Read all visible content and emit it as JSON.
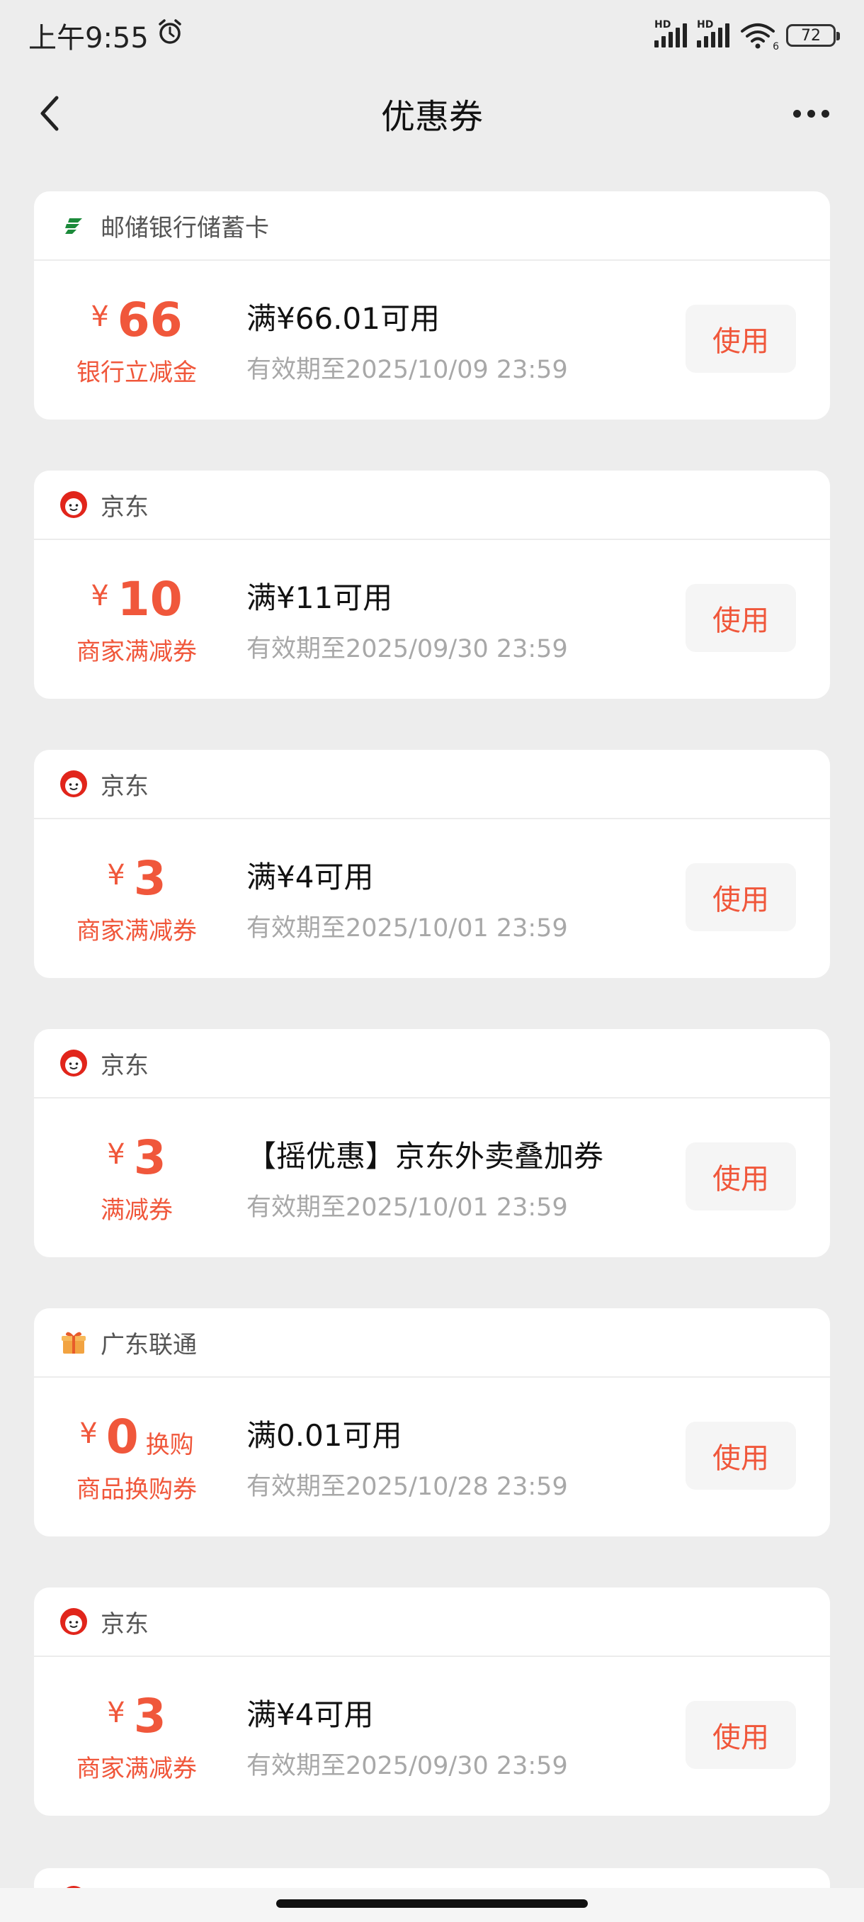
{
  "status_bar": {
    "time": "上午9:55",
    "battery": "72",
    "signal_label": "HD",
    "wifi_label": "6"
  },
  "nav": {
    "title": "优惠券"
  },
  "coupons": [
    {
      "merchant": "邮储银行储蓄卡",
      "logo": "postal-bank-logo-icon",
      "currency": "¥",
      "amount": "66",
      "extra": "",
      "type": "银行立减金",
      "condition": "满¥66.01可用",
      "expiry": "有效期至2025/10/09 23:59",
      "button": "使用"
    },
    {
      "merchant": "京东",
      "logo": "jd-logo-icon",
      "currency": "¥",
      "amount": "10",
      "extra": "",
      "type": "商家满减券",
      "condition": "满¥11可用",
      "expiry": "有效期至2025/09/30 23:59",
      "button": "使用"
    },
    {
      "merchant": "京东",
      "logo": "jd-logo-icon",
      "currency": "¥",
      "amount": "3",
      "extra": "",
      "type": "商家满减券",
      "condition": "满¥4可用",
      "expiry": "有效期至2025/10/01 23:59",
      "button": "使用"
    },
    {
      "merchant": "京东",
      "logo": "jd-logo-icon",
      "currency": "¥",
      "amount": "3",
      "extra": "",
      "type": "满减券",
      "condition": "【摇优惠】京东外卖叠加券",
      "expiry": "有效期至2025/10/01 23:59",
      "button": "使用"
    },
    {
      "merchant": "广东联通",
      "logo": "gift-box-icon",
      "currency": "¥",
      "amount": "0",
      "extra": "换购",
      "type": "商品换购券",
      "condition": "满0.01可用",
      "expiry": "有效期至2025/10/28 23:59",
      "button": "使用"
    },
    {
      "merchant": "京东",
      "logo": "jd-logo-icon",
      "currency": "¥",
      "amount": "3",
      "extra": "",
      "type": "商家满减券",
      "condition": "满¥4可用",
      "expiry": "有效期至2025/09/30 23:59",
      "button": "使用"
    }
  ],
  "colors": {
    "accent": "#f0573b",
    "background": "#ededed",
    "card": "#ffffff",
    "muted_text": "#a8a8a8"
  }
}
